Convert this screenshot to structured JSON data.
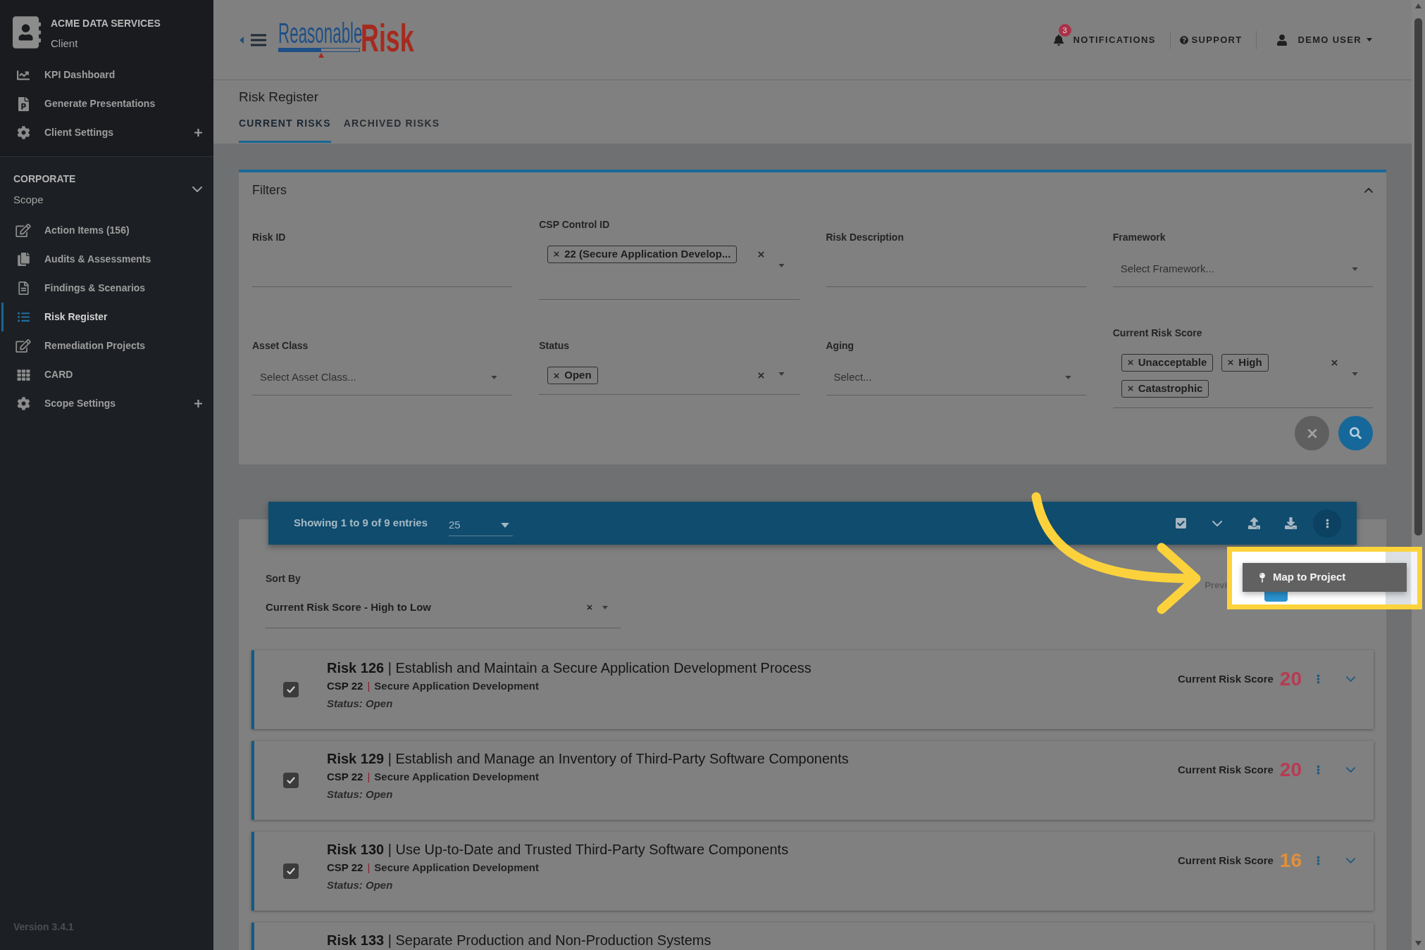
{
  "sidebar": {
    "client": {
      "name": "ACME DATA SERVICES",
      "subtitle": "Client"
    },
    "client_items": [
      {
        "label": "KPI Dashboard",
        "selected": false,
        "expandable": false
      },
      {
        "label": "Generate Presentations",
        "selected": false,
        "expandable": false
      },
      {
        "label": "Client Settings",
        "selected": false,
        "expandable": true
      }
    ],
    "scope": {
      "name": "CORPORATE",
      "subtitle": "Scope",
      "expanded": true
    },
    "scope_items": [
      {
        "label": "Action Items (156)",
        "selected": false,
        "expandable": false
      },
      {
        "label": "Audits & Assessments",
        "selected": false,
        "expandable": false
      },
      {
        "label": "Findings & Scenarios",
        "selected": false,
        "expandable": false
      },
      {
        "label": "Risk Register",
        "selected": true,
        "expandable": false
      },
      {
        "label": "Remediation Projects",
        "selected": false,
        "expandable": false
      },
      {
        "label": "CARD",
        "selected": false,
        "expandable": false
      },
      {
        "label": "Scope Settings",
        "selected": false,
        "expandable": true
      }
    ],
    "version": "Version 3.4.1"
  },
  "header": {
    "logo": {
      "word_1": "Reasonable",
      "word_2": "Risk"
    },
    "notifications": {
      "label": "NOTIFICATIONS",
      "count": "3"
    },
    "support": {
      "label": "SUPPORT"
    },
    "user": {
      "label": "DEMO USER"
    }
  },
  "page": {
    "title": "Risk Register",
    "tabs": [
      {
        "label": "CURRENT RISKS",
        "selected": true
      },
      {
        "label": "ARCHIVED RISKS",
        "selected": false
      }
    ]
  },
  "filters": {
    "title": "Filters",
    "expanded": true,
    "fields": [
      {
        "label": "Risk ID",
        "kind": "text"
      },
      {
        "label": "CSP Control ID",
        "kind": "tags",
        "tags": [
          "22 (Secure Application Develop..."
        ]
      },
      {
        "label": "Risk Description",
        "kind": "text"
      },
      {
        "label": "Framework",
        "kind": "select",
        "placeholder": "Select Framework..."
      },
      {
        "label": "Asset Class",
        "kind": "select",
        "placeholder": "Select Asset Class..."
      },
      {
        "label": "Status",
        "kind": "tags",
        "tags": [
          "Open"
        ]
      },
      {
        "label": "Aging",
        "kind": "select",
        "placeholder": "Select..."
      },
      {
        "label": "Current Risk Score",
        "kind": "tags",
        "tags": [
          "Unacceptable",
          "High",
          "Catastrophic"
        ]
      }
    ]
  },
  "results": {
    "summary": "Showing 1 to 9 of 9 entries",
    "page_size": "25",
    "sort": {
      "label": "Sort By",
      "value": "Current Risk Score - High to Low"
    },
    "pagination": {
      "previous": "Previ"
    },
    "menu": [
      {
        "label": "Map to Project"
      }
    ],
    "risks": [
      {
        "title": "**Risk 126** | Establish and Maintain a Secure Application Development Process",
        "csp": "CSP 22",
        "separator": "|",
        "control": "Secure Application Development",
        "status": "Status: Open",
        "score_label": "Current Risk Score",
        "score": "20",
        "color": "#b83a52",
        "checked": true,
        "expanded": false
      },
      {
        "title": "**Risk 129** | Establish and Manage an Inventory of Third-Party Software Components",
        "csp": "CSP 22",
        "separator": "|",
        "control": "Secure Application Development",
        "status": "Status: Open",
        "score_label": "Current Risk Score",
        "score": "20",
        "color": "#b83a52",
        "checked": true,
        "expanded": false
      },
      {
        "title": "**Risk 130** | Use Up-to-Date and Trusted Third-Party Software Components",
        "csp": "CSP 22",
        "separator": "|",
        "control": "Secure Application Development",
        "status": "Status: Open",
        "score_label": "Current Risk Score",
        "score": "16",
        "color": "#e0903c",
        "checked": true,
        "expanded": false
      },
      {
        "title": "**Risk 133** | Separate Production and Non-Production Systems"
      }
    ]
  }
}
